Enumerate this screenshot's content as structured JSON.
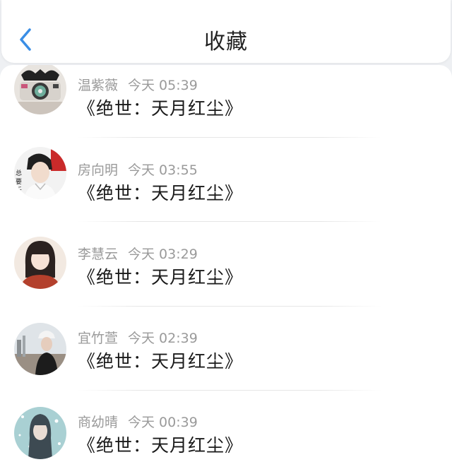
{
  "header": {
    "title": "收藏"
  },
  "items": [
    {
      "name": "温紫薇",
      "time": "今天 05:39",
      "content": "《绝世：天月红尘》"
    },
    {
      "name": "房向明",
      "time": "今天 03:55",
      "content": "《绝世：天月红尘》"
    },
    {
      "name": "李慧云",
      "time": "今天 03:29",
      "content": "《绝世：天月红尘》"
    },
    {
      "name": "宜竹萱",
      "time": "今天 02:39",
      "content": "《绝世：天月红尘》"
    },
    {
      "name": "商幼晴",
      "time": "今天 00:39",
      "content": "《绝世：天月红尘》"
    }
  ],
  "colors": {
    "accent": "#3a8ee6",
    "background": "#eef0f3",
    "meta_text": "#9a9a9a"
  },
  "icons": {
    "back": "chevron-left-icon"
  }
}
